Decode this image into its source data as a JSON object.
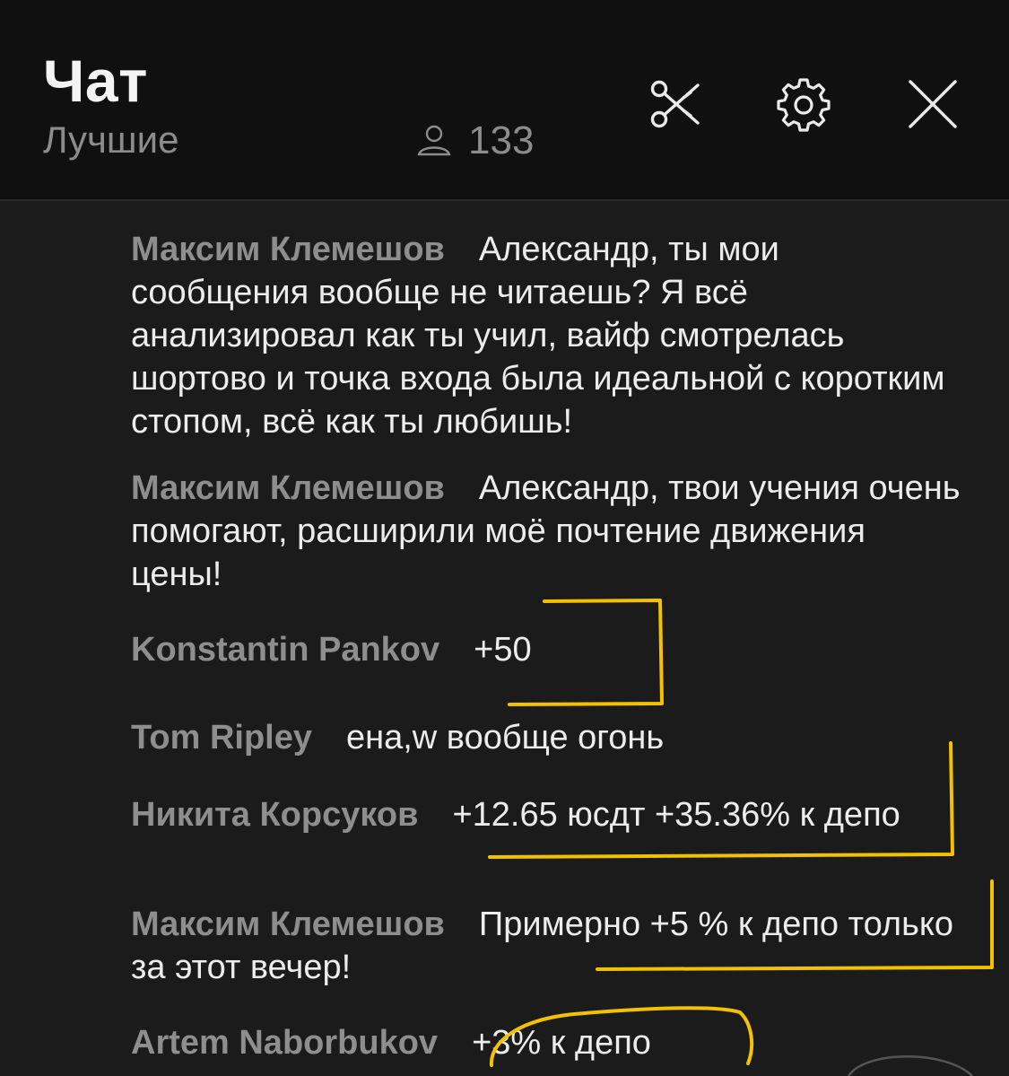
{
  "header": {
    "title": "Чат",
    "subtitle": "Лучшие",
    "online_count": "133",
    "icons": {
      "user": "user-icon",
      "scissors": "scissors-icon",
      "settings": "gear-icon",
      "close": "close-icon"
    }
  },
  "messages": [
    {
      "author": "Максим Клемешов",
      "text": "Александр, ты мои сообщения вообще не читаешь? Я всё анализировал как ты учил, вайф смотрелась шортово и точка входа была идеальной с коротким стопом, всё как ты любишь!"
    },
    {
      "author": "Максим Клемешов",
      "text": "Александр, твои учения очень помогают, расширили моё почтение движения цены!"
    },
    {
      "author": "Konstantin Pankov",
      "text": "+50"
    },
    {
      "author": "Tom Ripley",
      "text": "ена,w вообще огонь"
    },
    {
      "author": "Никита Корсуков",
      "text": "+12.65 юсдт +35.36% к депо"
    },
    {
      "author": "Максим Клемешов",
      "text": "Примерно +5 % к депо только за этот вечер!"
    },
    {
      "author": "Artem Naborbukov",
      "text": "+3% к депо"
    }
  ],
  "colors": {
    "background": "#1b1b1b",
    "header_background": "#101010",
    "author": "#8e8e8e",
    "text": "#ececec",
    "muted": "#8c8c8c",
    "highlight_marker": "#f2c200"
  }
}
